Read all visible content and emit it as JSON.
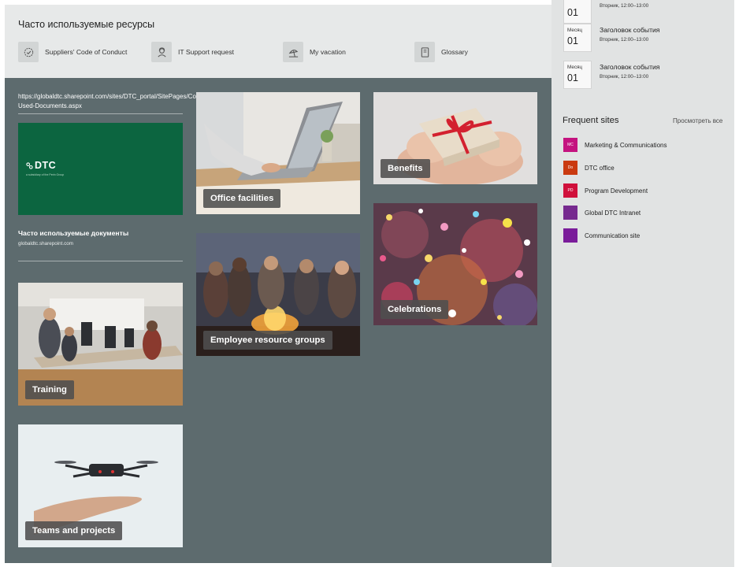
{
  "resources": {
    "title": "Часто используемые ресурсы",
    "items": [
      {
        "label": "Suppliers' Code of Conduct",
        "icon": "gear-badge-icon"
      },
      {
        "label": "IT Support request",
        "icon": "support-icon"
      },
      {
        "label": "My vacation",
        "icon": "beach-icon"
      },
      {
        "label": "Glossary",
        "icon": "book-icon"
      }
    ]
  },
  "left_column": {
    "url": "https://globaldtc.sharepoint.com/sites/DTC_portal/SitePages/Commonly-Used-Documents.aspx",
    "dtc_logo": "DTC",
    "dtc_tagline": "a subsidiary of the Perin Group",
    "docs_title": "Часто используемые документы",
    "docs_subtitle": "globaldtc.sharepoint.com"
  },
  "tiles": {
    "office": "Office facilities",
    "benefits": "Benefits",
    "employee": "Employee resource groups",
    "celebrations": "Celebrations",
    "training": "Training",
    "teams": "Teams and projects"
  },
  "events": [
    {
      "month": "",
      "day": "01",
      "title": "",
      "time": "Вторник, 12:00–13:00"
    },
    {
      "month": "Месяц",
      "day": "01",
      "title": "Заголовок события",
      "time": "Вторник, 12:00–13:00"
    },
    {
      "month": "Месяц",
      "day": "01",
      "title": "Заголовок события",
      "time": "Вторник, 12:00–13:00"
    }
  ],
  "frequent_sites": {
    "title": "Frequent sites",
    "see_all": "Просмотреть все",
    "sites": [
      {
        "abbr": "MC",
        "name": "Marketing & Communications",
        "color": "#c4137f"
      },
      {
        "abbr": "Do",
        "name": "DTC office",
        "color": "#ca3a10"
      },
      {
        "abbr": "PD",
        "name": "Program Development",
        "color": "#d0103b"
      },
      {
        "abbr": "",
        "name": "Global DTC Intranet",
        "color": "#762a8f"
      },
      {
        "abbr": "",
        "name": "Communication site",
        "color": "#7a1c9a"
      }
    ]
  },
  "colors": {
    "dark_section": "#5d6b6e",
    "resources_bg": "#e7e9e9",
    "right_panel": "#e1e3e3",
    "dtc_green": "#0c6540"
  }
}
